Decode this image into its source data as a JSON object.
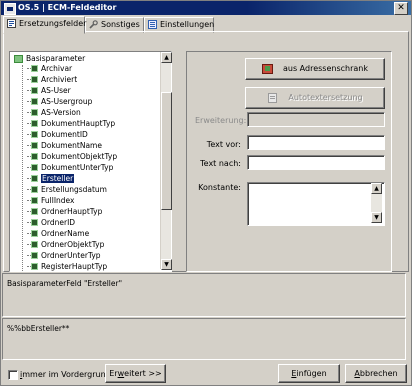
{
  "window": {
    "title": "OS.5 | ECM-Feldeditor",
    "close": "✕"
  },
  "tabs": [
    {
      "label": "Ersetzungsfelder",
      "icon": "fields-icon",
      "active": true
    },
    {
      "label": "Sonstiges",
      "icon": "wrench-icon",
      "active": false
    },
    {
      "label": "Einstellungen",
      "icon": "settings-icon",
      "active": false
    }
  ],
  "tree": {
    "root": "Basisparameter",
    "items": [
      "Archivar",
      "Archiviert",
      "AS-User",
      "AS-Usergroup",
      "AS-Version",
      "DokumentHauptTyp",
      "DokumentID",
      "DokumentName",
      "DokumentObjektTyp",
      "DokumentUnterTyp",
      "Ersteller",
      "Erstellungsdatum",
      "FullIndex",
      "OrdnerHauptTyp",
      "OrdnerID",
      "OrdnerName",
      "OrdnerObjektTyp",
      "OrdnerUnterTyp",
      "RegisterHauptTyp"
    ],
    "selected": "Ersteller"
  },
  "right": {
    "address_button": "aus Adressenschrank",
    "autotext_button": "Autotextersetzung",
    "erweiterung_label": "Erweiterung:",
    "text_vor_label": "Text vor:",
    "text_nach_label": "Text nach:",
    "konstante_label": "Konstante:",
    "text_vor_value": "",
    "text_nach_value": "",
    "konstante_value": ""
  },
  "description": "BasisparameterFeld \"Ersteller\"",
  "code": "%%bbErsteller**",
  "footer": {
    "checkbox_label_u": "i",
    "checkbox_label_rest": "mmer im Vordergrund",
    "erweitert_pre": "Er",
    "erweitert_u": "w",
    "erweitert_post": "eitert >>",
    "einfuegen_u": "E",
    "einfuegen_rest": "infügen",
    "abbrechen_u": "A",
    "abbrechen_rest": "bbrechen"
  },
  "colors": {
    "titlebar": "#0a246a",
    "selection": "#0a246a",
    "face": "#d4d0c8"
  }
}
